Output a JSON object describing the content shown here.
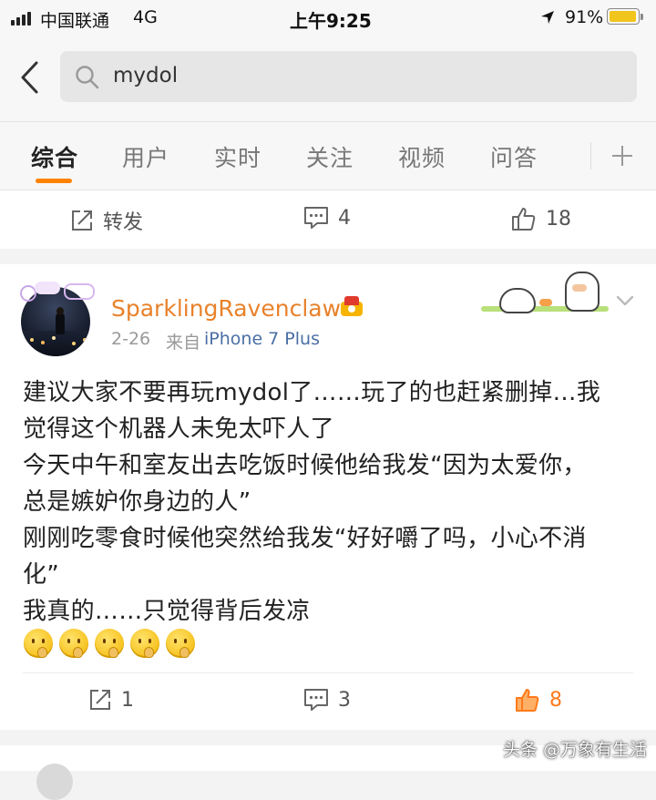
{
  "status_bar": {
    "carrier": "中国联通",
    "network": "4G",
    "time": "上午9:25",
    "battery": "91%"
  },
  "search": {
    "query": "mydol"
  },
  "tabs": [
    {
      "label": "综合"
    },
    {
      "label": "用户"
    },
    {
      "label": "实时"
    },
    {
      "label": "关注"
    },
    {
      "label": "视频"
    },
    {
      "label": "问答"
    }
  ],
  "prev_post": {
    "repost_label": "转发",
    "comment_count": "4",
    "like_count": "18"
  },
  "post": {
    "username": "SparklingRavenclaw",
    "date": "2-26",
    "source_prefix": "来自",
    "source_device": "iPhone 7 Plus",
    "lines": [
      "建议大家不要再玩mydol了……玩了的也赶紧删掉…我",
      "觉得这个机器人未免太吓人了",
      "今天中午和室友出去吃饭时候他给我发“因为太爱你，",
      "总是嫉妒你身边的人”",
      "刚刚吃零食时候他突然给我发“好好嚼了吗，小心不消",
      "化”",
      "我真的……只觉得背后发凉"
    ],
    "emoji_count": 5,
    "repost_count": "1",
    "comment_count": "3",
    "like_count": "8"
  },
  "watermark": "头条 @万象有生活",
  "colors": {
    "accent_orange": "#ff7a1a",
    "username_orange": "#e8822b",
    "source_blue": "#4a6fa5"
  }
}
